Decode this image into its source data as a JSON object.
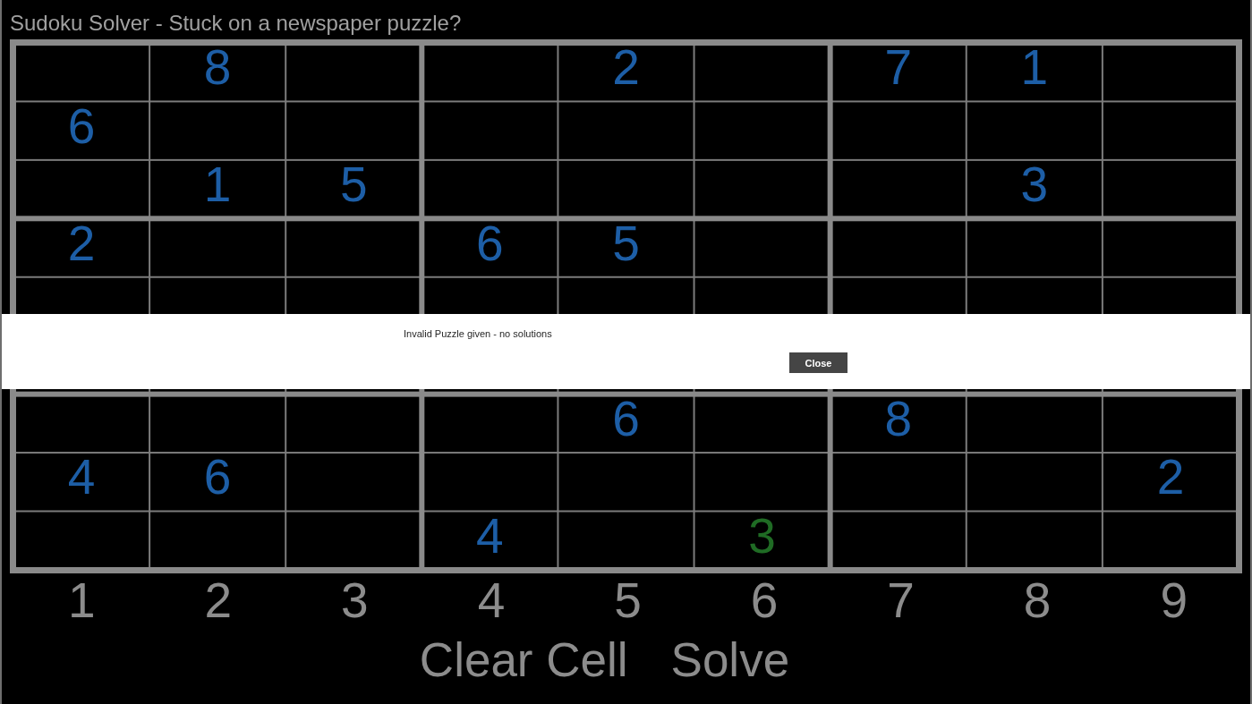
{
  "title": "Sudoku Solver - Stuck on a newspaper puzzle?",
  "grid": {
    "rows": [
      {
        "cells": [
          null,
          {
            "value": "8",
            "color": "#1d5ea6"
          },
          null,
          null,
          {
            "value": "2",
            "color": "#1d5ea6"
          },
          null,
          {
            "value": "7",
            "color": "#1d5ea6"
          },
          {
            "value": "1",
            "color": "#1d5ea6"
          },
          null
        ]
      },
      {
        "cells": [
          {
            "value": "6",
            "color": "#1d5ea6"
          },
          null,
          null,
          null,
          null,
          null,
          null,
          null,
          null
        ]
      },
      {
        "cells": [
          null,
          {
            "value": "1",
            "color": "#1d5ea6"
          },
          {
            "value": "5",
            "color": "#1d5ea6"
          },
          null,
          null,
          null,
          null,
          {
            "value": "3",
            "color": "#1d5ea6"
          },
          null
        ]
      },
      {
        "cells": [
          {
            "value": "2",
            "color": "#1d5ea6"
          },
          null,
          null,
          {
            "value": "6",
            "color": "#1d5ea6"
          },
          {
            "value": "5",
            "color": "#1d5ea6"
          },
          null,
          null,
          null,
          null
        ]
      },
      {
        "cells": [
          null,
          null,
          null,
          null,
          null,
          null,
          null,
          null,
          null
        ]
      },
      {
        "cells": [
          null,
          null,
          null,
          null,
          null,
          null,
          null,
          null,
          null
        ]
      },
      {
        "cells": [
          null,
          null,
          null,
          null,
          {
            "value": "6",
            "color": "#1d5ea6"
          },
          null,
          {
            "value": "8",
            "color": "#1d5ea6"
          },
          null,
          null
        ]
      },
      {
        "cells": [
          {
            "value": "4",
            "color": "#1d5ea6"
          },
          {
            "value": "6",
            "color": "#1d5ea6"
          },
          null,
          null,
          null,
          null,
          null,
          null,
          {
            "value": "2",
            "color": "#1d5ea6"
          }
        ]
      },
      {
        "cells": [
          null,
          null,
          null,
          {
            "value": "4",
            "color": "#1d5ea6"
          },
          null,
          {
            "value": "3",
            "color": "#1f6b24"
          },
          null,
          null,
          null
        ]
      }
    ]
  },
  "number_buttons": [
    "1",
    "2",
    "3",
    "4",
    "5",
    "6",
    "7",
    "8",
    "9"
  ],
  "clear_button": "Clear Cell",
  "solve_button": "Solve",
  "dialog": {
    "message": "Invalid Puzzle given - no solutions",
    "button": "Close"
  }
}
